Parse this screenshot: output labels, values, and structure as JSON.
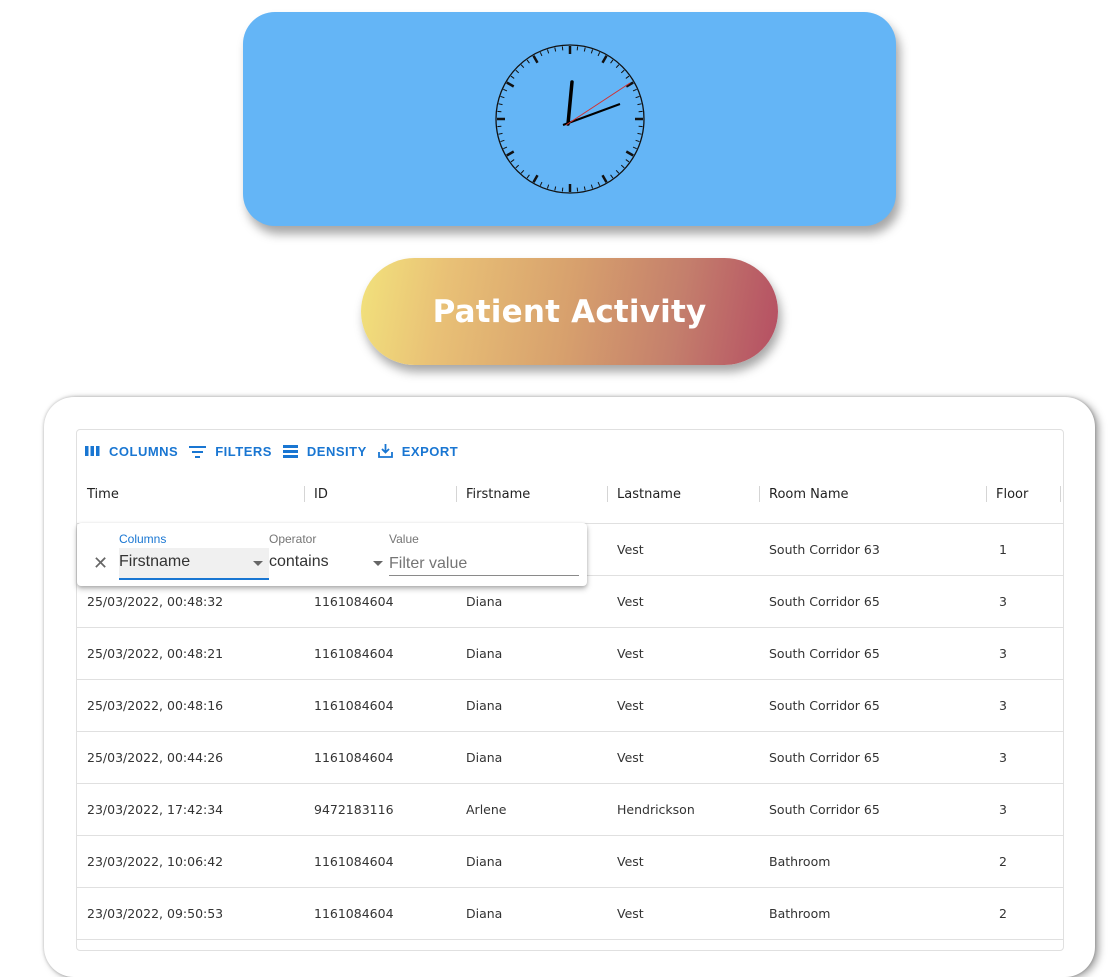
{
  "page": {
    "title": "Patient Activity"
  },
  "toolbar": {
    "columns_label": "COLUMNS",
    "filters_label": "FILTERS",
    "density_label": "DENSITY",
    "export_label": "EXPORT"
  },
  "table": {
    "headers": [
      "Time",
      "ID",
      "Firstname",
      "Lastname",
      "Room Name",
      "Floor"
    ],
    "rows": [
      [
        "",
        "",
        "",
        "Vest",
        "South Corridor 63",
        "1"
      ],
      [
        "25/03/2022, 00:48:32",
        "1161084604",
        "Diana",
        "Vest",
        "South Corridor 65",
        "3"
      ],
      [
        "25/03/2022, 00:48:21",
        "1161084604",
        "Diana",
        "Vest",
        "South Corridor 65",
        "3"
      ],
      [
        "25/03/2022, 00:48:16",
        "1161084604",
        "Diana",
        "Vest",
        "South Corridor 65",
        "3"
      ],
      [
        "25/03/2022, 00:44:26",
        "1161084604",
        "Diana",
        "Vest",
        "South Corridor 65",
        "3"
      ],
      [
        "23/03/2022, 17:42:34",
        "9472183116",
        "Arlene",
        "Hendrickson",
        "South Corridor 65",
        "3"
      ],
      [
        "23/03/2022, 10:06:42",
        "1161084604",
        "Diana",
        "Vest",
        "Bathroom",
        "2"
      ],
      [
        "23/03/2022, 09:50:53",
        "1161084604",
        "Diana",
        "Vest",
        "Bathroom",
        "2"
      ]
    ]
  },
  "filter": {
    "columns_label": "Columns",
    "columns_value": "Firstname",
    "operator_label": "Operator",
    "operator_value": "contains",
    "value_label": "Value",
    "value_placeholder": "Filter value"
  },
  "colors": {
    "clock_card": "#64b5f6",
    "accent": "#1976d2",
    "gradient_start": "#f2e27c",
    "gradient_end": "#b54e63"
  }
}
